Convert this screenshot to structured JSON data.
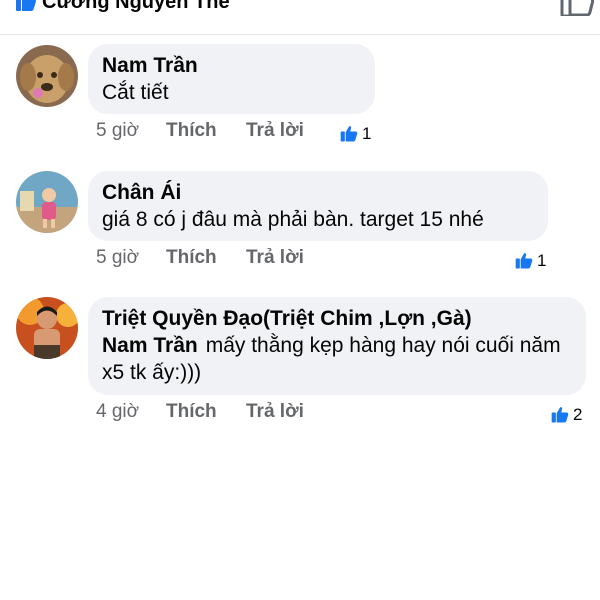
{
  "header": {
    "name": "Cường Nguyễn Thế"
  },
  "comments": [
    {
      "author": "Nam Trần",
      "mention": "",
      "text": "Cắt tiết",
      "time": "5 giờ",
      "like_label": "Thích",
      "reply_label": "Trả lời",
      "reaction_count": "1"
    },
    {
      "author": "Chân Ái",
      "mention": "",
      "text": "giá 8 có j đâu mà phải bàn. target 15 nhé",
      "time": "5 giờ",
      "like_label": "Thích",
      "reply_label": "Trả lời",
      "reaction_count": "1"
    },
    {
      "author": "Triệt Quyền Đạo(Triệt Chim ,Lợn ,Gà)",
      "mention": "Nam Trần",
      "text": "mấy thằng kẹp hàng hay nói cuối năm x5 tk ấy:)))",
      "time": "4 giờ",
      "like_label": "Thích",
      "reply_label": "Trả lời",
      "reaction_count": "2"
    }
  ],
  "colors": {
    "like_blue": "#1877f2",
    "bubble": "#f0f2f5",
    "meta_gray": "#65676b"
  },
  "icons": {
    "reaction": "thumbs-up-icon"
  }
}
